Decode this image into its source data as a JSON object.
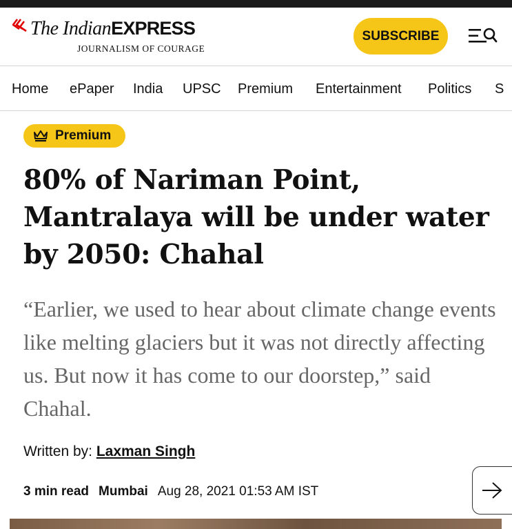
{
  "header": {
    "logo_part1": "The Indian",
    "logo_part2": "EXPRESS",
    "tagline": "JOURNALISM OF COURAGE",
    "subscribe_label": "SUBSCRIBE",
    "brand_color": "#e10000",
    "accent_color": "#f5c518"
  },
  "nav": {
    "items": [
      "Home",
      "ePaper",
      "India",
      "UPSC",
      "Premium",
      "Entertainment",
      "Politics",
      "S"
    ]
  },
  "article": {
    "badge_label": "Premium",
    "headline": "80% of Nariman Point, Mantralaya will be under water by 2050: Chahal",
    "summary": "“Earlier, we used to hear about climate change events like melting glaciers but it was not directly affecting us. But now it has come to our doorstep,” said Chahal.",
    "byline_prefix": "Written by: ",
    "author": "Laxman Singh",
    "read_time": "3 min read",
    "location": "Mumbai",
    "date": "Aug 28, 2021 01:53 AM IST"
  },
  "icons": {
    "logo": "indian-express-logo-mark",
    "menu": "menu-icon",
    "search": "search-icon",
    "premium": "crown-icon",
    "next": "arrow-right-icon"
  }
}
